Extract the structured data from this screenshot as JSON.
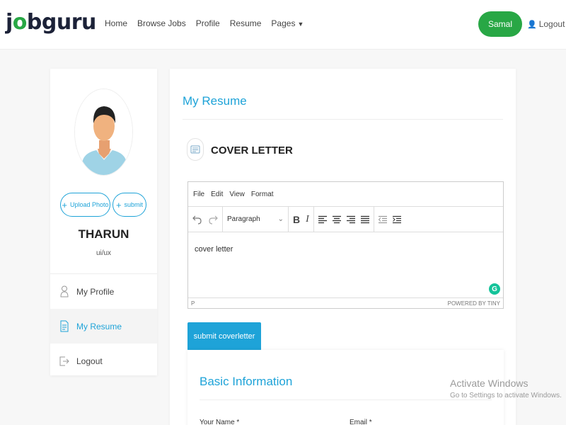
{
  "header": {
    "logo_prefix": "j",
    "logo_o": "o",
    "logo_suffix": "bguru",
    "nav": [
      "Home",
      "Browse Jobs",
      "Profile",
      "Resume",
      "Pages"
    ],
    "user_button": "Samal",
    "logout": "Logout"
  },
  "sidebar": {
    "upload_photo": "Upload Photo",
    "submit": "submit",
    "name": "THARUN",
    "role": "ui/ux",
    "menu": [
      {
        "label": "My Profile",
        "icon": "user-icon"
      },
      {
        "label": "My Resume",
        "icon": "document-icon"
      },
      {
        "label": "Logout",
        "icon": "logout-icon"
      }
    ]
  },
  "main": {
    "title": "My Resume",
    "cover_letter_title": "COVER LETTER",
    "editor": {
      "menus": [
        "File",
        "Edit",
        "View",
        "Format"
      ],
      "block_format": "Paragraph",
      "content": "cover letter",
      "path": "P",
      "powered_by": "POWERED BY TINY"
    },
    "submit_button": "submit coverletter",
    "basic_info": {
      "title": "Basic Information",
      "name_label": "Your Name *",
      "email_label": "Email *"
    }
  },
  "watermark": {
    "line1": "Activate Windows",
    "line2": "Go to Settings to activate Windows."
  },
  "colors": {
    "accent": "#1ea3d8",
    "brand_green": "#28a745",
    "background": "#f7f7f7"
  }
}
